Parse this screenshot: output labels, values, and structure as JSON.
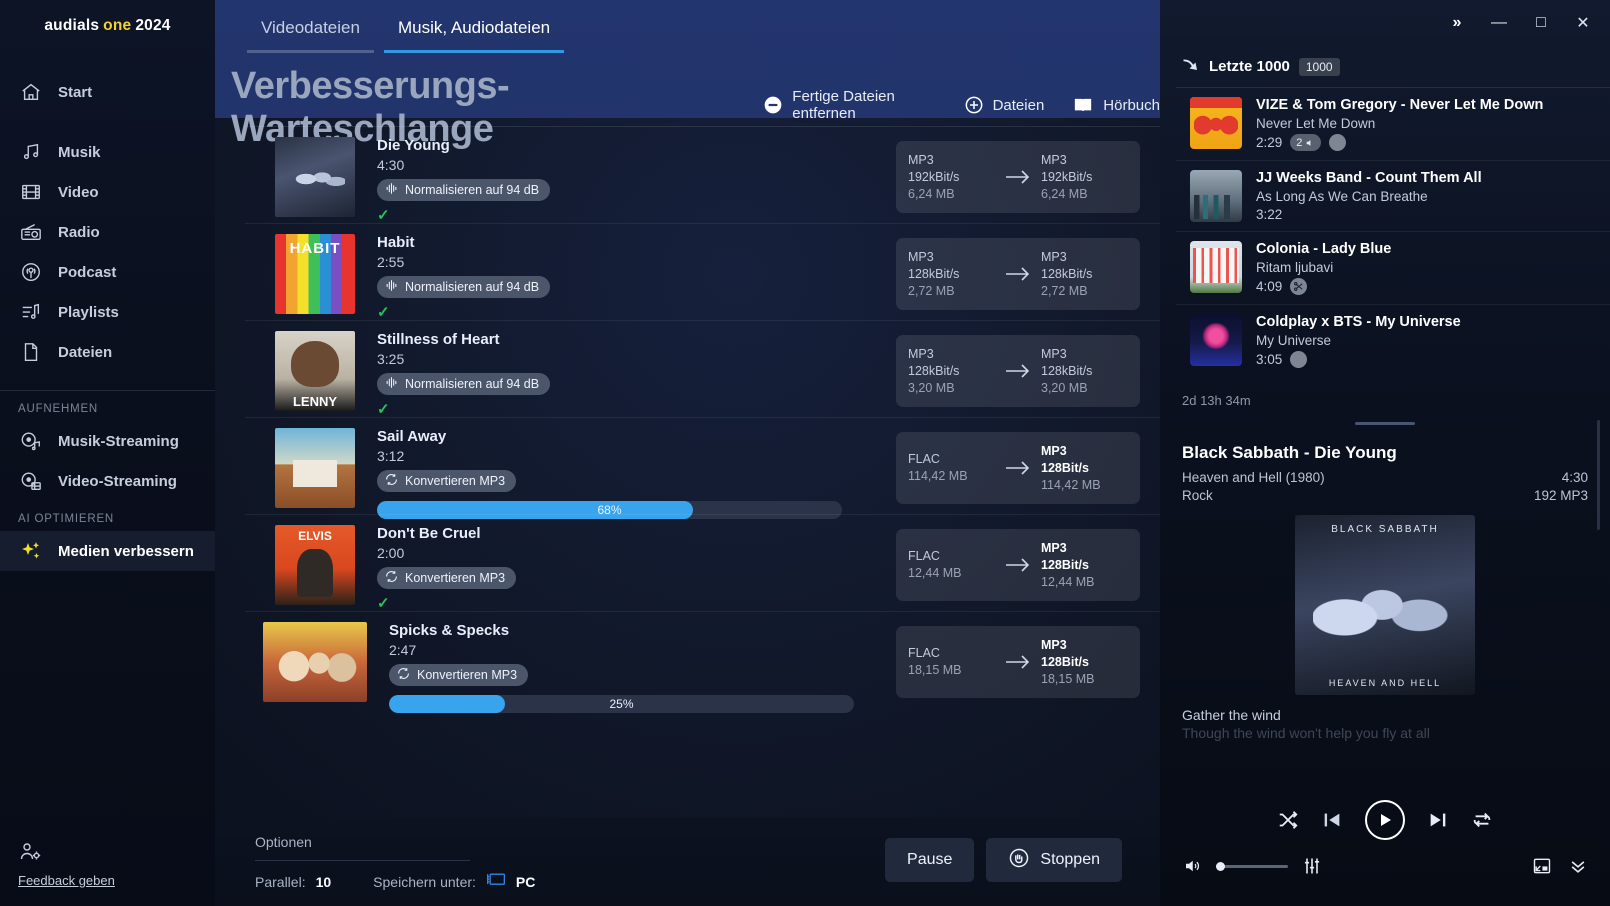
{
  "brand": {
    "part1": "audials",
    "part2": "one",
    "part3": "2024"
  },
  "sidebar": {
    "items": [
      {
        "label": "Start",
        "icon": "home-icon"
      },
      {
        "label": "Musik",
        "icon": "music-note-icon"
      },
      {
        "label": "Video",
        "icon": "film-icon"
      },
      {
        "label": "Radio",
        "icon": "radio-icon"
      },
      {
        "label": "Podcast",
        "icon": "podcast-icon"
      },
      {
        "label": "Playlists",
        "icon": "playlist-icon"
      },
      {
        "label": "Dateien",
        "icon": "file-icon"
      }
    ],
    "section_record": "AUFNEHMEN",
    "record_items": [
      {
        "label": "Musik-Streaming",
        "icon": "record-music-icon"
      },
      {
        "label": "Video-Streaming",
        "icon": "record-video-icon"
      }
    ],
    "section_ai": "AI OPTIMIEREN",
    "ai_items": [
      {
        "label": "Medien verbessern",
        "icon": "sparkle-icon"
      }
    ],
    "feedback": "Feedback geben"
  },
  "window": {
    "expand": "»",
    "minimize": "—",
    "maximize": "□",
    "close": "✕"
  },
  "tabs": [
    {
      "label": "Videodateien",
      "active": false
    },
    {
      "label": "Musik, Audiodateien",
      "active": true
    }
  ],
  "page": {
    "title": "Verbesserungs-Warteschlange",
    "actions": [
      {
        "label": "Fertige Dateien entfernen",
        "icon": "minus-circle-icon"
      },
      {
        "label": "Dateien",
        "icon": "plus-circle-icon"
      },
      {
        "label": "Hörbuch",
        "icon": "book-icon"
      }
    ]
  },
  "queue": {
    "rows": [
      {
        "title": "Die Young",
        "duration": "4:30",
        "task": "Normalisieren auf 94 dB",
        "task_icon": "waveform-icon",
        "done": true,
        "progress": null,
        "art": "art-sabbath",
        "source": {
          "format": "MP3",
          "bitrate": "192kBit/s",
          "size": "6,24 MB"
        },
        "target": {
          "format": "MP3",
          "bitrate": "192kBit/s",
          "size": "6,24 MB"
        },
        "target_strong": false
      },
      {
        "title": "Habit",
        "duration": "2:55",
        "task": "Normalisieren auf 94 dB",
        "task_icon": "waveform-icon",
        "done": true,
        "progress": null,
        "art": "art-habit",
        "source": {
          "format": "MP3",
          "bitrate": "128kBit/s",
          "size": "2,72 MB"
        },
        "target": {
          "format": "MP3",
          "bitrate": "128kBit/s",
          "size": "2,72 MB"
        },
        "target_strong": false
      },
      {
        "title": "Stillness of Heart",
        "duration": "3:25",
        "task": "Normalisieren auf 94 dB",
        "task_icon": "waveform-icon",
        "done": true,
        "progress": null,
        "art": "art-lenny",
        "source": {
          "format": "MP3",
          "bitrate": "128kBit/s",
          "size": "3,20 MB"
        },
        "target": {
          "format": "MP3",
          "bitrate": "128kBit/s",
          "size": "3,20 MB"
        },
        "target_strong": false
      },
      {
        "title": "Sail Away",
        "duration": "3:12",
        "task": "Konvertieren MP3",
        "task_icon": "convert-icon",
        "done": false,
        "progress": 68,
        "progress_label": "68%",
        "art": "art-sail",
        "source": {
          "format": "FLAC",
          "bitrate": "",
          "size": "114,42 MB"
        },
        "target": {
          "format": "MP3",
          "bitrate": "128Bit/s",
          "size": "114,42 MB"
        },
        "target_strong": true
      },
      {
        "title": "Don't Be Cruel",
        "duration": "2:00",
        "task": "Konvertieren MP3",
        "task_icon": "convert-icon",
        "done": true,
        "progress": null,
        "art": "art-elvis",
        "source": {
          "format": "FLAC",
          "bitrate": "",
          "size": "12,44 MB"
        },
        "target": {
          "format": "MP3",
          "bitrate": "128Bit/s",
          "size": "12,44 MB"
        },
        "target_strong": true
      },
      {
        "title": "Spicks & Specks",
        "duration": "2:47",
        "task": "Konvertieren MP3",
        "task_icon": "convert-icon",
        "done": false,
        "progress": 25,
        "progress_label": "25%",
        "art": "art-bg",
        "source": {
          "format": "FLAC",
          "bitrate": "",
          "size": "18,15 MB"
        },
        "target": {
          "format": "MP3",
          "bitrate": "128Bit/s",
          "size": "18,15 MB"
        },
        "target_strong": true
      }
    ]
  },
  "bottom": {
    "options_label": "Optionen",
    "parallel_label": "Parallel:",
    "parallel_value": "10",
    "save_label": "Speichern unter:",
    "save_value": "PC",
    "pause_label": "Pause",
    "stop_label": "Stoppen"
  },
  "right": {
    "header": {
      "title": "Letzte 1000",
      "badge": "1000",
      "icon": "arrow-curve-icon"
    },
    "tracks": [
      {
        "name": "VIZE & Tom Gregory - Never Let Me Down",
        "album": "Never Let Me Down",
        "duration": "2:29",
        "art": "art-vize",
        "pill": "2",
        "has_circle": true
      },
      {
        "name": "JJ Weeks Band - Count Them All",
        "album": "As Long As We Can Breathe",
        "duration": "3:22",
        "art": "art-jj",
        "pill": null,
        "has_circle": false
      },
      {
        "name": "Colonia - Lady Blue",
        "album": "Ritam ljubavi",
        "duration": "4:09",
        "art": "art-colonia",
        "pill": null,
        "has_circle": false,
        "has_scissors": true
      },
      {
        "name": "Coldplay x BTS - My Universe",
        "album": "My Universe",
        "duration": "3:05",
        "art": "art-coldplay",
        "pill": null,
        "has_circle": true
      }
    ],
    "elapsed": "2d 13h 34m",
    "now_playing": {
      "title": "Black Sabbath - Die Young",
      "album": "Heaven and Hell (1980)",
      "duration": "4:30",
      "genre": "Rock",
      "quality": "192 MP3",
      "cover_top_text": "BLACK SABBATH",
      "cover_bottom_text": "HEAVEN AND HELL",
      "lyric1": "Gather the wind",
      "lyric2": "Though the wind won't help you fly at all"
    },
    "player": {
      "shuffle": "shuffle-icon",
      "previous": "previous-icon",
      "play": "play-icon",
      "next": "next-icon",
      "repeat": "repeat-icon",
      "volume": "volume-icon",
      "equalizer": "equalizer-icon",
      "mini": "mini-player-icon",
      "collapse": "chevron-double-down-icon"
    }
  },
  "colors": {
    "accent": "#38a4ee",
    "brand_yellow": "#f2d22e",
    "done_green": "#25c25e",
    "header_blue": "#23356e"
  }
}
